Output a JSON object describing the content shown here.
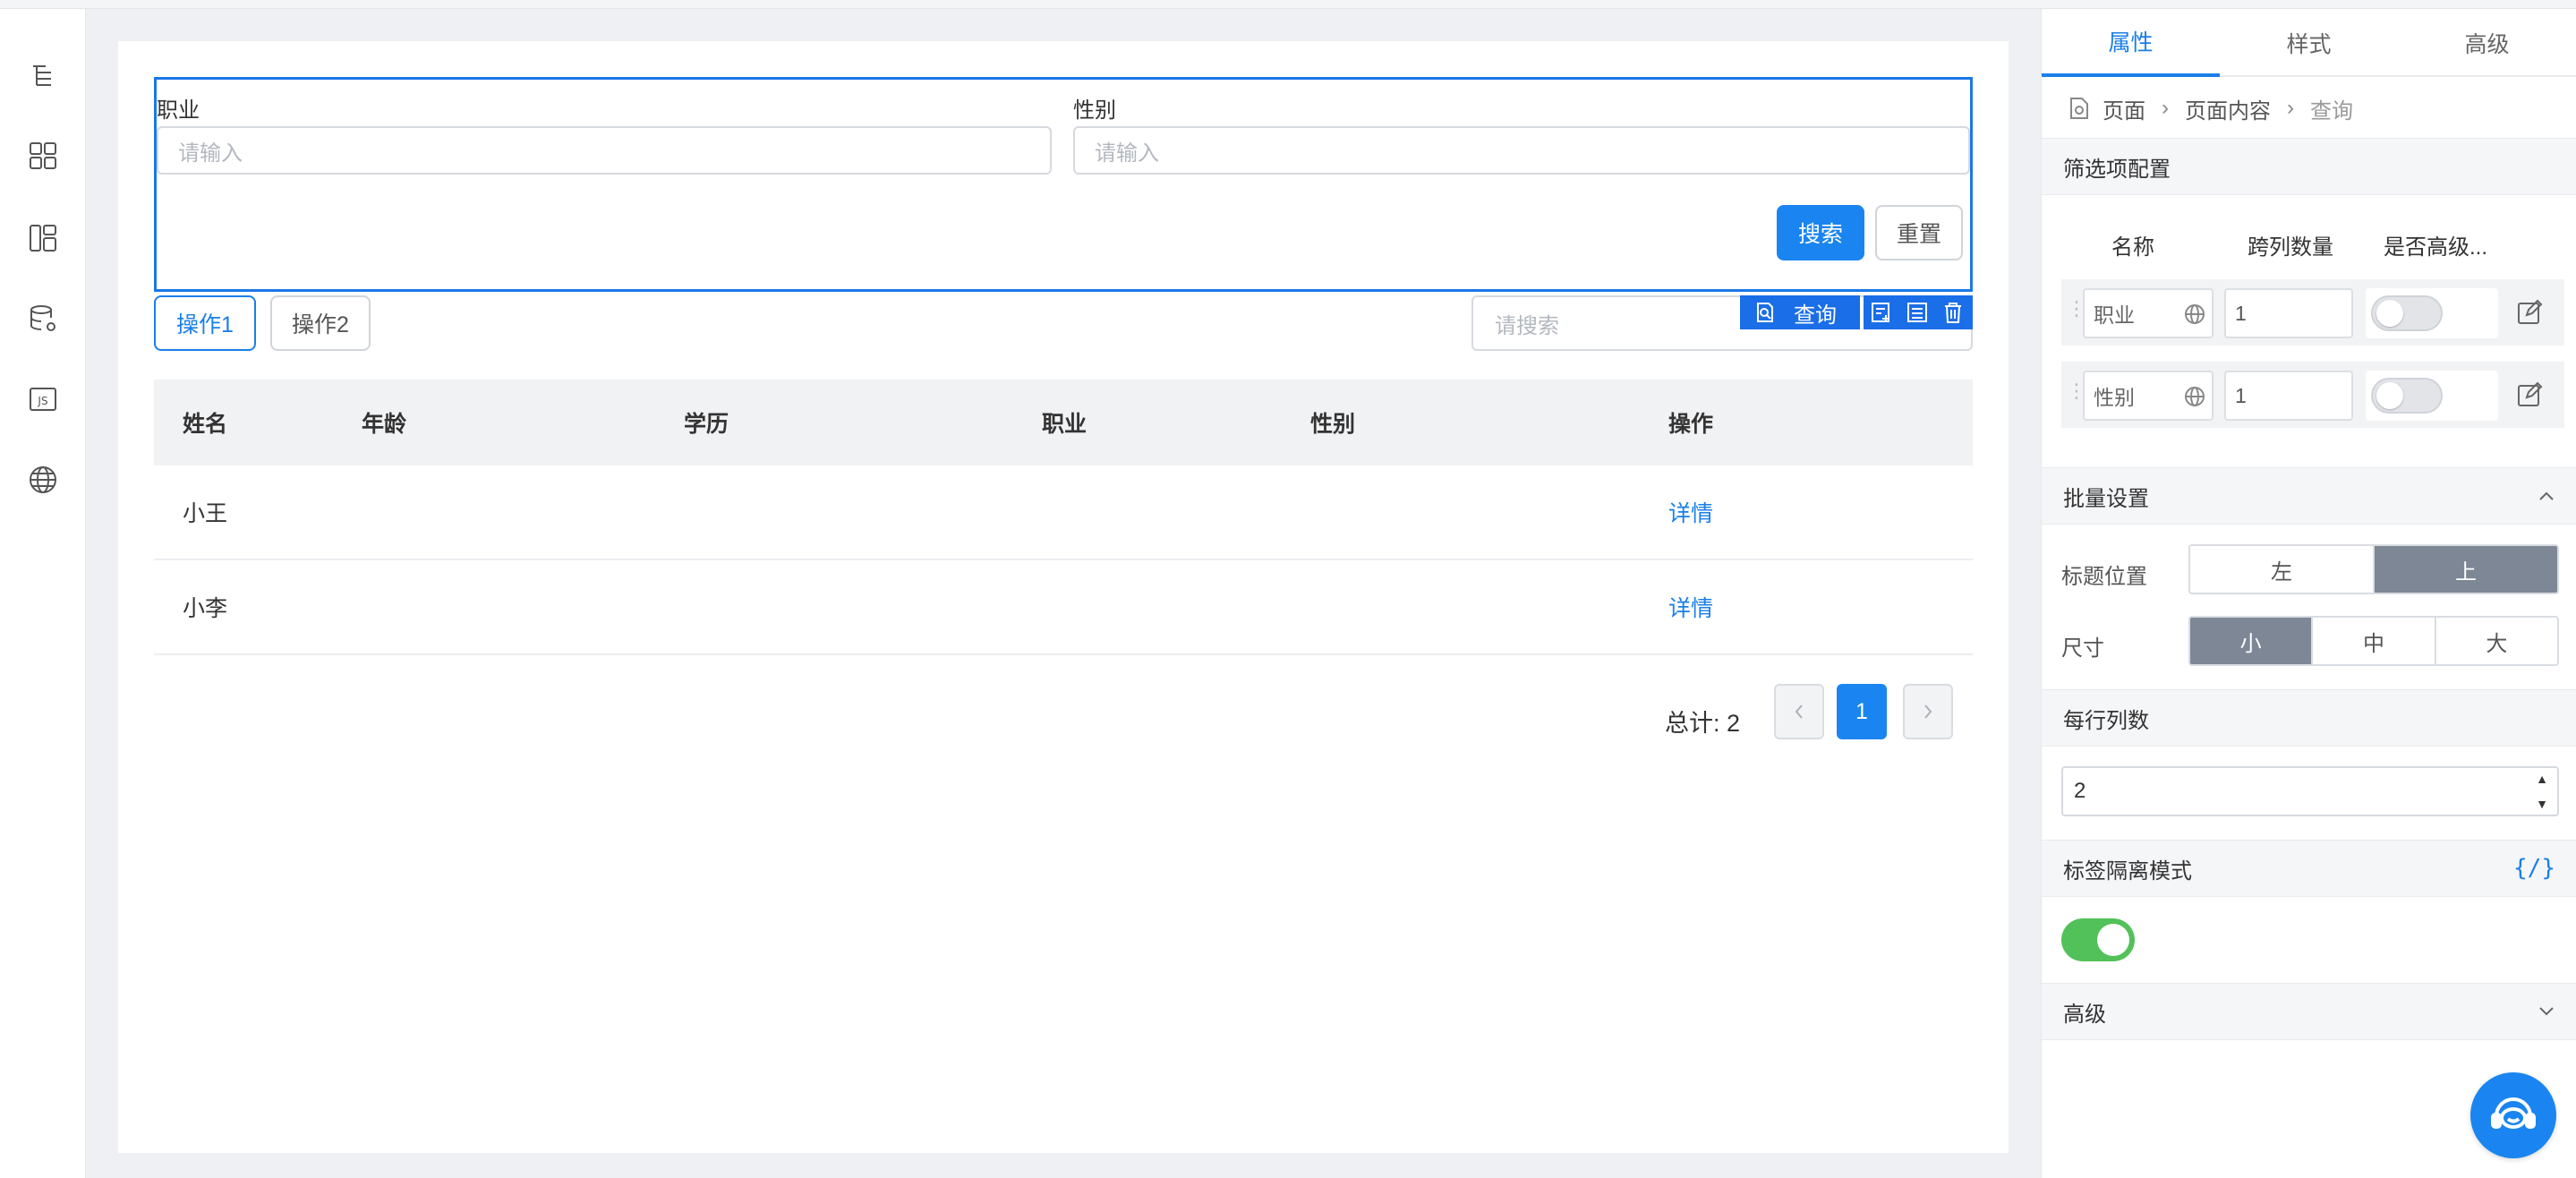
{
  "query_form": {
    "fields": [
      {
        "label": "职业",
        "placeholder": "请输入"
      },
      {
        "label": "性别",
        "placeholder": "请输入"
      }
    ],
    "search_button": "搜索",
    "reset_button": "重置"
  },
  "actions": {
    "op1": "操作1",
    "op2": "操作2",
    "search_placeholder": "请搜索"
  },
  "component_toolbar": {
    "label": "查询"
  },
  "table": {
    "columns": [
      "姓名",
      "年龄",
      "学历",
      "职业",
      "性别",
      "操作"
    ],
    "rows": [
      {
        "name": "小王",
        "action": "详情"
      },
      {
        "name": "小李",
        "action": "详情"
      }
    ]
  },
  "pagination": {
    "total": "总计: 2",
    "current_page": "1"
  },
  "panel": {
    "tabs": [
      "属性",
      "样式",
      "高级"
    ],
    "active_tab": "属性",
    "breadcrumb": [
      "页面",
      "页面内容",
      "查询"
    ],
    "filter_section": {
      "title": "筛选项配置",
      "col_name": "名称",
      "col_span": "跨列数量",
      "col_advanced": "是否高级...",
      "items": [
        {
          "name": "职业",
          "span": "1",
          "advanced": false
        },
        {
          "name": "性别",
          "span": "1",
          "advanced": false
        }
      ]
    },
    "batch_section": {
      "title": "批量设置",
      "title_position_label": "标题位置",
      "title_position_options": [
        "左",
        "上"
      ],
      "title_position_selected": "上",
      "size_label": "尺寸",
      "size_options": [
        "小",
        "中",
        "大"
      ],
      "size_selected": "小"
    },
    "columns_per_row": {
      "title": "每行列数",
      "value": "2"
    },
    "label_isolation": {
      "title": "标签隔离模式",
      "code_icon_text": "{/}",
      "enabled": true
    },
    "advanced_section": {
      "title": "高级"
    }
  },
  "colors": {
    "primary": "#1a85f0",
    "selection": "#1a78e8",
    "toggle_on": "#52c15a",
    "segment_active": "#7d8796"
  }
}
